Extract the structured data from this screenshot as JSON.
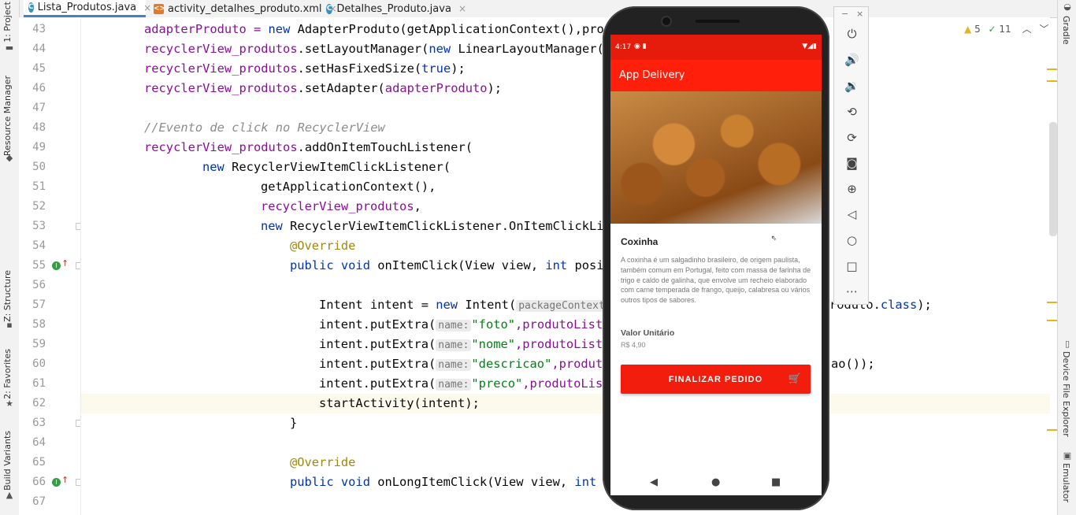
{
  "tabs": [
    {
      "label": "Lista_Produtos.java",
      "icon": "java-class-icon",
      "active": true
    },
    {
      "label": "activity_detalhes_produto.xml",
      "icon": "xml-file-icon",
      "active": false
    },
    {
      "label": "Detalhes_Produto.java",
      "icon": "java-class-icon",
      "active": false
    }
  ],
  "left_tools": {
    "project": "1: Project",
    "resource_manager": "Resource Manager",
    "structure": "Z: Structure",
    "favorites": "2: Favorites",
    "build_variants": "Build Variants"
  },
  "right_tools": {
    "gradle": "Gradle",
    "device_file_explorer": "Device File Explorer",
    "emulator": "Emulator"
  },
  "inspections": {
    "warnings": "5",
    "weak_warnings": "11"
  },
  "line_numbers": [
    "43",
    "44",
    "45",
    "46",
    "47",
    "48",
    "49",
    "50",
    "51",
    "52",
    "53",
    "54",
    "55",
    "56",
    "57",
    "58",
    "59",
    "60",
    "61",
    "62",
    "63",
    "64",
    "65",
    "66",
    "67"
  ],
  "code": {
    "l43a": "adapterProduto = ",
    "l43b": "new",
    "l43c": " AdapterProduto(getApplicationContext(),pro",
    "l44a": "recyclerView_produtos",
    "l44b": ".setLayoutManager(",
    "l44c": "new",
    "l44d": " LinearLayoutManager(",
    "l45a": "recyclerView_produtos",
    "l45b": ".setHasFixedSize(",
    "l45c": "true",
    "l45d": ");",
    "l46a": "recyclerView_produtos",
    "l46b": ".setAdapter(",
    "l46c": "adapterProduto",
    "l46d": ");",
    "l48": "//Evento de click no RecyclerView",
    "l49a": "recyclerView_produtos",
    "l49b": ".addOnItemTouchListener(",
    "l50a": "new",
    "l50b": " RecyclerViewItemClickListener(",
    "l51": "getApplicationContext(),",
    "l52a": "recyclerView_produtos",
    "l52b": ",",
    "l53a": "new",
    "l53b": " RecyclerViewItemClickListener.OnItemClickLi",
    "l54": "@Override",
    "l55a": "public",
    "l55b": " ",
    "l55c": "void",
    "l55d": " onItemClick(View view, ",
    "l55e": "int",
    "l55f": " posi",
    "l57a": "Intent intent = ",
    "l57b": "new",
    "l57c": " Intent(",
    "l57h": "packageContext",
    "l57r1": "roduto.",
    "l57r2": "class",
    "l57r3": ");",
    "l58a": "intent.putExtra(",
    "l58h": "name:",
    "l58s": "\"foto\"",
    "l58b": ",produtoList",
    "l59a": "intent.putExtra(",
    "l59h": "name:",
    "l59s": "\"nome\"",
    "l59b": ",produtoList",
    "l60a": "intent.putExtra(",
    "l60h": "name:",
    "l60s": "\"descricao\"",
    "l60b": ",produt",
    "l60r": "ao());",
    "l61a": "intent.putExtra(",
    "l61h": "name:",
    "l61s": "\"preco\"",
    "l61b": ",produtoLis",
    "l62": "startActivity(intent);",
    "l63": "}",
    "l65": "@Override",
    "l66a": "public",
    "l66b": " ",
    "l66c": "void",
    "l66d": " onLongItemClick(View view, ",
    "l66e": "int"
  },
  "phone": {
    "status_time": "4:17",
    "app_title": "App Delivery",
    "product_name": "Coxinha",
    "description": "A coxinha é um salgadinho brasileiro, de origem paulista, também comum em Portugal, feito com massa de farinha de trigo e caldo de galinha, que envolve um recheio elaborado com carne temperada de frango, queijo, calabresa ou vários outros tipos de sabores.",
    "price_label": "Valor Unitário",
    "price_value": "R$ 4,90",
    "button_label": "FINALIZAR PEDIDO"
  },
  "emulator_toolbar": {
    "minimize": "−",
    "close": "×",
    "icons": [
      "power-icon",
      "volume-up-icon",
      "volume-down-icon",
      "rotate-left-icon",
      "rotate-right-icon",
      "camera-icon",
      "zoom-icon",
      "back-icon",
      "home-icon",
      "overview-icon",
      "more-icon"
    ]
  },
  "colors": {
    "accent": "#ff1f0a",
    "status_bar": "#e51c0c",
    "keyword": "#0033b3",
    "field": "#871094",
    "string": "#067d17"
  }
}
